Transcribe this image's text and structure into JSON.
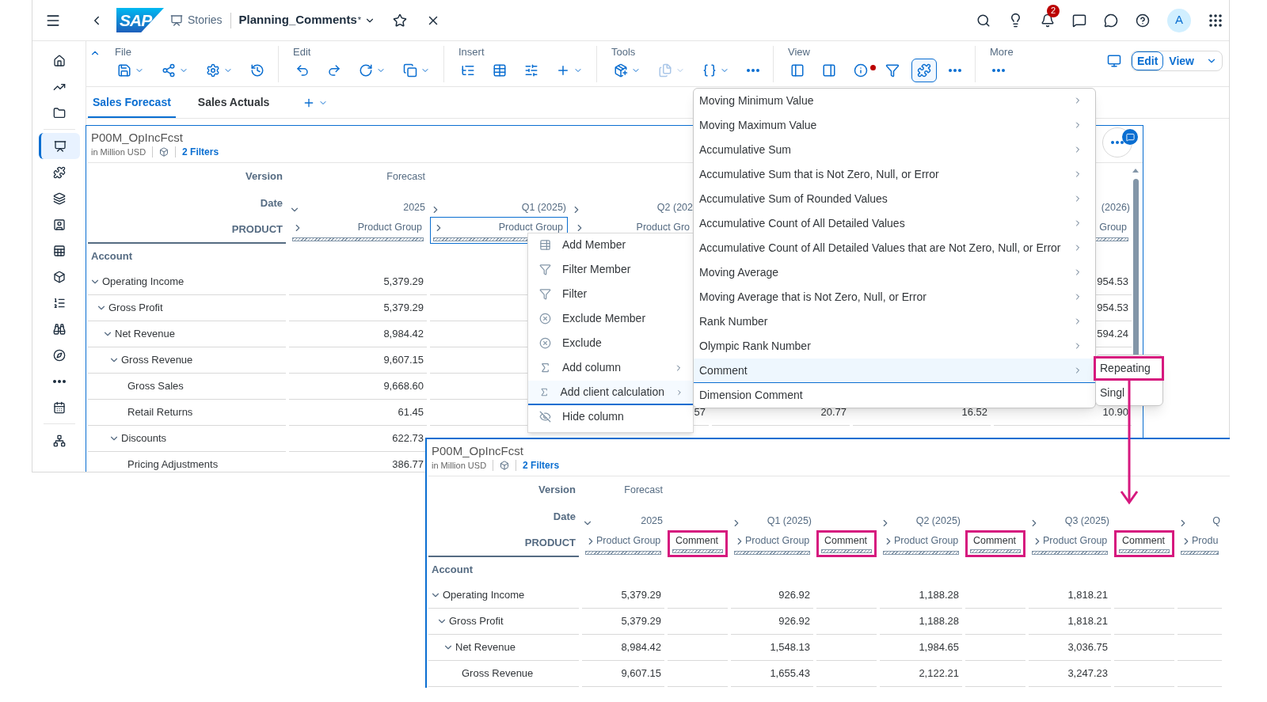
{
  "shell": {
    "logo": "SAP",
    "breadcrumb": "Stories",
    "title": "Planning_Comments",
    "title_mark": "*",
    "notification_count": "2",
    "avatar": "A"
  },
  "sidebar": {
    "items": [
      {
        "kind": "home",
        "selected": false
      },
      {
        "kind": "trend",
        "selected": false
      },
      {
        "kind": "folder",
        "selected": false
      },
      {
        "kind": "stories",
        "selected": true
      },
      {
        "kind": "puzzle",
        "selected": false
      },
      {
        "kind": "layers",
        "selected": false
      },
      {
        "kind": "user-board",
        "selected": false
      },
      {
        "kind": "sheet",
        "selected": false
      },
      {
        "kind": "cube",
        "selected": false
      },
      {
        "kind": "list",
        "selected": false
      },
      {
        "kind": "binoculars",
        "selected": false
      },
      {
        "kind": "compass",
        "selected": false
      },
      {
        "kind": "more",
        "selected": false
      },
      {
        "kind": "calendar",
        "selected": false
      },
      {
        "kind": "network",
        "selected": false
      }
    ]
  },
  "toolbar": {
    "groups": [
      {
        "label": "File",
        "tools": [
          {
            "kind": "save",
            "dropdown": true,
            "selected": false,
            "disabled": false,
            "dot": false
          },
          {
            "kind": "share",
            "dropdown": true,
            "selected": false,
            "disabled": false,
            "dot": false
          },
          {
            "kind": "settings",
            "dropdown": true,
            "selected": false,
            "disabled": false,
            "dot": false
          },
          {
            "kind": "history",
            "dropdown": false,
            "selected": false,
            "disabled": false,
            "dot": false
          }
        ]
      },
      {
        "label": "Edit",
        "tools": [
          {
            "kind": "undo",
            "dropdown": false,
            "selected": false,
            "disabled": false,
            "dot": false
          },
          {
            "kind": "redo",
            "dropdown": false,
            "selected": false,
            "disabled": false,
            "dot": false
          },
          {
            "kind": "refresh",
            "dropdown": true,
            "selected": false,
            "disabled": false,
            "dot": false
          },
          {
            "kind": "copy",
            "dropdown": true,
            "selected": false,
            "disabled": false,
            "dot": false
          }
        ]
      },
      {
        "label": "Insert",
        "tools": [
          {
            "kind": "list-tree",
            "dropdown": false,
            "selected": false,
            "disabled": false,
            "dot": false
          },
          {
            "kind": "table",
            "dropdown": false,
            "selected": false,
            "disabled": false,
            "dot": false
          },
          {
            "kind": "sliders",
            "dropdown": false,
            "selected": false,
            "disabled": false,
            "dot": false
          },
          {
            "kind": "plus",
            "dropdown": true,
            "selected": false,
            "disabled": false,
            "dot": false
          }
        ]
      },
      {
        "label": "Tools",
        "tools": [
          {
            "kind": "package-plus",
            "dropdown": true,
            "selected": false,
            "disabled": false,
            "dot": false
          },
          {
            "kind": "files",
            "dropdown": true,
            "selected": false,
            "disabled": true,
            "dot": false
          },
          {
            "kind": "braces",
            "dropdown": true,
            "selected": false,
            "disabled": false,
            "dot": false
          },
          {
            "kind": "more",
            "dropdown": false,
            "selected": false,
            "disabled": false,
            "dot": false
          }
        ]
      },
      {
        "label": "View",
        "tools": [
          {
            "kind": "panel-left",
            "dropdown": false,
            "selected": false,
            "disabled": false,
            "dot": false
          },
          {
            "kind": "panel-right",
            "dropdown": false,
            "selected": false,
            "disabled": false,
            "dot": false
          },
          {
            "kind": "info",
            "dropdown": false,
            "selected": false,
            "disabled": false,
            "dot": true
          },
          {
            "kind": "filter",
            "dropdown": false,
            "selected": false,
            "disabled": false,
            "dot": false
          },
          {
            "kind": "puzzle",
            "dropdown": false,
            "selected": true,
            "disabled": false,
            "dot": false
          },
          {
            "kind": "more",
            "dropdown": false,
            "selected": false,
            "disabled": false,
            "dot": false
          }
        ]
      },
      {
        "label": "More",
        "tools": [
          {
            "kind": "more",
            "dropdown": false,
            "selected": false,
            "disabled": false,
            "dot": false
          }
        ]
      }
    ]
  },
  "mode_switch": [
    {
      "label": "Edit",
      "selected": true
    },
    {
      "label": "View",
      "selected": false
    }
  ],
  "tabs": [
    {
      "label": "Sales Forecast",
      "selected": true
    },
    {
      "label": "Sales Actuals",
      "selected": false
    }
  ],
  "widget": {
    "title": "P00M_OpIncFcst",
    "unit": "in Million USD",
    "filters": "2 Filters",
    "header_rows": [
      {
        "label": "Version",
        "cells": {
          "column_1": {
            "text": "Forecast"
          }
        }
      },
      {
        "label": "Date",
        "cells": {
          "column_1": {
            "text": "2025",
            "expanded": true
          },
          "column_2": {
            "text": "Q1 (2025)",
            "expanded": false
          },
          "column_3": {
            "text": "Q2 (202",
            "expanded": false
          },
          "column_6": {
            "text": "(2026)"
          }
        }
      },
      {
        "label": "PRODUCT",
        "cells": {
          "column_1": {
            "text": "Product Group",
            "expanded": false,
            "selected": false
          },
          "column_2": {
            "text": "Product Group",
            "expanded": false,
            "selected": true
          },
          "column_3": {
            "text": "Product Gro",
            "expanded": false,
            "selected": false
          },
          "column_6": {
            "text": "Group",
            "selected": false
          }
        }
      }
    ],
    "row_header": "Account",
    "rows": [
      {
        "label": "Operating Income",
        "values": {
          "column_1": "5,379.29",
          "column_6": "954.53"
        },
        "children": [
          {
            "label": "Gross Profit",
            "values": {
              "column_1": "5,379.29",
              "column_6": "954.53"
            },
            "children": [
              {
                "label": "Net Revenue",
                "values": {
                  "column_1": "8,984.42",
                  "column_6": "594.24"
                },
                "children": [
                  {
                    "label": "Gross Revenue",
                    "values": {
                      "column_1": "9,607.15"
                    },
                    "children": [
                      {
                        "label": "Gross Sales",
                        "values": {
                          "column_1": "9,668.60"
                        }
                      },
                      {
                        "label": "Retail Returns",
                        "values": {
                          "column_1": "61.45",
                          "column_3": "57",
                          "column_4": "20.77",
                          "column_5": "16.52",
                          "column_6": "10.90"
                        }
                      }
                    ]
                  },
                  {
                    "label": "Discounts",
                    "values": {
                      "column_1": "622.73"
                    },
                    "children": [
                      {
                        "label": "Pricing Adjustments",
                        "values": {
                          "column_1": "386.77"
                        }
                      }
                    ]
                  }
                ]
              }
            ]
          }
        ]
      }
    ]
  },
  "context_menu": {
    "items": [
      {
        "kind": "add-member",
        "label": "Add Member",
        "submenu": false,
        "selected": false
      },
      {
        "kind": "filter",
        "label": "Filter Member",
        "submenu": false,
        "selected": false
      },
      {
        "kind": "filter",
        "label": "Filter",
        "submenu": false,
        "selected": false
      },
      {
        "kind": "exclude",
        "label": "Exclude Member",
        "submenu": false,
        "selected": false
      },
      {
        "kind": "exclude",
        "label": "Exclude",
        "submenu": false,
        "selected": false
      },
      {
        "kind": "function",
        "label": "Add column",
        "submenu": true,
        "selected": false
      },
      {
        "kind": "function",
        "label": "Add client calculation",
        "submenu": true,
        "selected": true
      },
      {
        "kind": "hide",
        "label": "Hide column",
        "submenu": false,
        "selected": false
      }
    ]
  },
  "calculation_menu": {
    "items": [
      {
        "label": "Moving Minimum Value",
        "submenu": true,
        "selected": false
      },
      {
        "label": "Moving Maximum Value",
        "submenu": true,
        "selected": false
      },
      {
        "label": "Accumulative Sum",
        "submenu": true,
        "selected": false
      },
      {
        "label": "Accumulative Sum that is Not Zero, Null, or Error",
        "submenu": true,
        "selected": false
      },
      {
        "label": "Accumulative Sum of Rounded Values",
        "submenu": true,
        "selected": false
      },
      {
        "label": "Accumulative Count of All Detailed Values",
        "submenu": true,
        "selected": false
      },
      {
        "label": "Accumulative Count of All Detailed Values that are Not Zero, Null, or Error",
        "submenu": true,
        "selected": false
      },
      {
        "label": "Moving Average",
        "submenu": true,
        "selected": false
      },
      {
        "label": "Moving Average that is Not Zero, Null, or Error",
        "submenu": true,
        "selected": false
      },
      {
        "label": "Rank Number",
        "submenu": true,
        "selected": false
      },
      {
        "label": "Olympic Rank Number",
        "submenu": true,
        "selected": false
      },
      {
        "label": "Comment",
        "submenu": true,
        "selected": true
      },
      {
        "label": "Dimension Comment",
        "submenu": false,
        "selected": false
      }
    ]
  },
  "comment_menu": {
    "items": [
      {
        "label": "Repeating",
        "highlighted": true
      },
      {
        "label": "Singl",
        "highlighted": false
      }
    ]
  },
  "result_widget": {
    "title": "P00M_OpIncFcst",
    "unit": "in Million USD",
    "filters": "2 Filters",
    "header_rows": [
      {
        "label": "Version",
        "cells": {
          "column_1": {
            "text": "Forecast"
          }
        }
      },
      {
        "label": "Date",
        "cells": {
          "column_1": {
            "text": "2025",
            "expanded": true
          },
          "column_3": {
            "text": "Q1 (2025)",
            "expanded": false
          },
          "column_5": {
            "text": "Q2 (2025)",
            "expanded": false
          },
          "column_7": {
            "text": "Q3 (2025)",
            "expanded": false
          },
          "column_9": {
            "text": "Q",
            "expanded": false
          }
        }
      },
      {
        "label": "PRODUCT",
        "cells": {
          "column_1": {
            "text": "Product Group",
            "expanded": false,
            "highlighted": false
          },
          "column_2": {
            "text": "Comment",
            "highlighted": true
          },
          "column_3": {
            "text": "Product Group",
            "expanded": false,
            "highlighted": false
          },
          "column_4": {
            "text": "Comment",
            "highlighted": true
          },
          "column_5": {
            "text": "Product Group",
            "expanded": false,
            "highlighted": false
          },
          "column_6": {
            "text": "Comment",
            "highlighted": true
          },
          "column_7": {
            "text": "Product Group",
            "expanded": false,
            "highlighted": false
          },
          "column_8": {
            "text": "Comment",
            "highlighted": true
          },
          "column_9": {
            "text": "Produ",
            "expanded": false,
            "highlighted": false
          }
        }
      }
    ],
    "row_header": "Account",
    "rows": [
      {
        "label": "Operating Income",
        "values": {
          "column_1": "5,379.29",
          "column_3": "926.92",
          "column_5": "1,188.28",
          "column_7": "1,818.21"
        },
        "children": [
          {
            "label": "Gross Profit",
            "values": {
              "column_1": "5,379.29",
              "column_3": "926.92",
              "column_5": "1,188.28",
              "column_7": "1,818.21"
            },
            "children": [
              {
                "label": "Net Revenue",
                "values": {
                  "column_1": "8,984.42",
                  "column_3": "1,548.13",
                  "column_5": "1,984.65",
                  "column_7": "3,036.75"
                },
                "children": [
                  {
                    "label": "Gross Revenue",
                    "values": {
                      "column_1": "9,607.15",
                      "column_3": "1,655.43",
                      "column_5": "2,122.21",
                      "column_7": "3,247.23"
                    }
                  }
                ]
              }
            ]
          }
        ]
      }
    ]
  }
}
